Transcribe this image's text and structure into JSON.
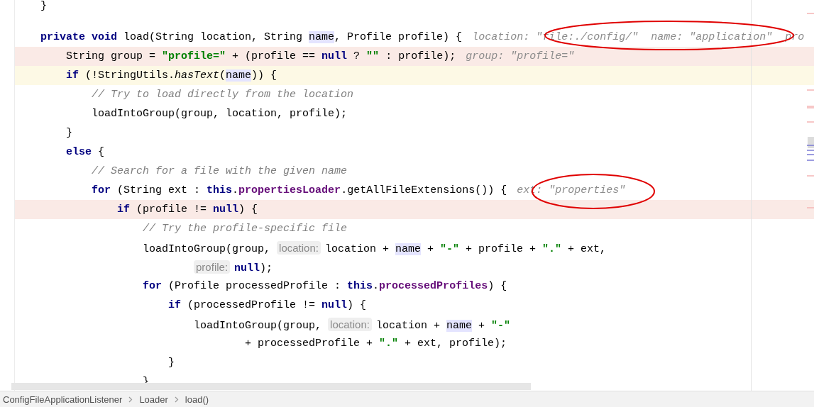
{
  "editor": {
    "lines": [
      {
        "kind": "code",
        "breakpoint": false,
        "caret_line": false,
        "segments": [
          {
            "kind": "code",
            "tokens": [
              {
                "kind": "plain",
                "text": "}"
              }
            ]
          }
        ]
      },
      {
        "kind": "blank",
        "breakpoint": false,
        "caret_line": false
      },
      {
        "kind": "code",
        "breakpoint": false,
        "caret_line": false,
        "segments": [
          {
            "kind": "code",
            "tokens": [
              {
                "kind": "keyword",
                "text": "private void"
              },
              {
                "kind": "plain",
                "text": " load(String location, String "
              },
              {
                "kind": "usage",
                "text": "name"
              },
              {
                "kind": "plain",
                "text": ", Profile profile) {"
              }
            ]
          },
          {
            "kind": "hint",
            "text": "location: \"file:./config/\"  name: \"application\"  pro"
          }
        ],
        "children": [
          {
            "kind": "code",
            "breakpoint": true,
            "caret_line": false,
            "segments": [
              {
                "kind": "code",
                "tokens": [
                  {
                    "kind": "plain",
                    "text": "String group = "
                  },
                  {
                    "kind": "string",
                    "text": "\"profile=\""
                  },
                  {
                    "kind": "plain",
                    "text": " + (profile == "
                  },
                  {
                    "kind": "keyword",
                    "text": "null"
                  },
                  {
                    "kind": "plain",
                    "text": " ? "
                  },
                  {
                    "kind": "string",
                    "text": "\"\""
                  },
                  {
                    "kind": "plain",
                    "text": " : profile);"
                  }
                ]
              },
              {
                "kind": "hint",
                "text": "group: \"profile=\""
              }
            ]
          },
          {
            "kind": "code",
            "breakpoint": false,
            "caret_line": true,
            "segments": [
              {
                "kind": "code",
                "tokens": [
                  {
                    "kind": "keyword",
                    "text": "if"
                  },
                  {
                    "kind": "plain",
                    "text": " (!StringUtils."
                  },
                  {
                    "kind": "method",
                    "text": "hasText"
                  },
                  {
                    "kind": "plain",
                    "text": "("
                  },
                  {
                    "kind": "usage",
                    "text": "name"
                  },
                  {
                    "kind": "plain",
                    "text": ")) {"
                  }
                ]
              }
            ],
            "children": [
              {
                "kind": "code",
                "breakpoint": false,
                "caret_line": false,
                "segments": [
                  {
                    "kind": "code",
                    "tokens": [
                      {
                        "kind": "comment",
                        "text": "// Try to load directly from the location"
                      }
                    ]
                  }
                ]
              },
              {
                "kind": "code",
                "breakpoint": false,
                "caret_line": false,
                "segments": [
                  {
                    "kind": "code",
                    "tokens": [
                      {
                        "kind": "plain",
                        "text": "loadIntoGroup(group, location, profile);"
                      }
                    ]
                  }
                ]
              }
            ]
          },
          {
            "kind": "code",
            "breakpoint": false,
            "caret_line": false,
            "segments": [
              {
                "kind": "code",
                "tokens": [
                  {
                    "kind": "plain",
                    "text": "}"
                  }
                ]
              }
            ]
          },
          {
            "kind": "code",
            "breakpoint": false,
            "caret_line": false,
            "segments": [
              {
                "kind": "code",
                "tokens": [
                  {
                    "kind": "keyword",
                    "text": "else"
                  },
                  {
                    "kind": "plain",
                    "text": " {"
                  }
                ]
              }
            ],
            "children": [
              {
                "kind": "code",
                "breakpoint": false,
                "caret_line": false,
                "segments": [
                  {
                    "kind": "code",
                    "tokens": [
                      {
                        "kind": "comment",
                        "text": "// Search for a file with the given name"
                      }
                    ]
                  }
                ]
              },
              {
                "kind": "code",
                "breakpoint": false,
                "caret_line": false,
                "segments": [
                  {
                    "kind": "code",
                    "tokens": [
                      {
                        "kind": "keyword",
                        "text": "for"
                      },
                      {
                        "kind": "plain",
                        "text": " (String ext : "
                      },
                      {
                        "kind": "keyword",
                        "text": "this"
                      },
                      {
                        "kind": "plain",
                        "text": "."
                      },
                      {
                        "kind": "field",
                        "text": "propertiesLoader"
                      },
                      {
                        "kind": "plain",
                        "text": ".getAllFileExtensions()) {"
                      }
                    ]
                  },
                  {
                    "kind": "hint",
                    "text": "ext: \"properties\""
                  }
                ],
                "children": [
                  {
                    "kind": "code",
                    "breakpoint": true,
                    "caret_line": false,
                    "segments": [
                      {
                        "kind": "code",
                        "tokens": [
                          {
                            "kind": "keyword",
                            "text": "if"
                          },
                          {
                            "kind": "plain",
                            "text": " (profile != "
                          },
                          {
                            "kind": "keyword",
                            "text": "null"
                          },
                          {
                            "kind": "plain",
                            "text": ") {"
                          }
                        ]
                      }
                    ],
                    "children": [
                      {
                        "kind": "code",
                        "breakpoint": false,
                        "caret_line": false,
                        "segments": [
                          {
                            "kind": "code",
                            "tokens": [
                              {
                                "kind": "comment",
                                "text": "// Try the profile-specific file"
                              }
                            ]
                          }
                        ]
                      },
                      {
                        "kind": "code",
                        "breakpoint": false,
                        "caret_line": false,
                        "segments": [
                          {
                            "kind": "code",
                            "tokens": [
                              {
                                "kind": "plain",
                                "text": "loadIntoGroup(group, "
                              }
                            ]
                          },
                          {
                            "kind": "param",
                            "text": "location:"
                          },
                          {
                            "kind": "code",
                            "tokens": [
                              {
                                "kind": "plain",
                                "text": "location + "
                              },
                              {
                                "kind": "usage",
                                "text": "name"
                              },
                              {
                                "kind": "plain",
                                "text": " + "
                              },
                              {
                                "kind": "string",
                                "text": "\"-\""
                              },
                              {
                                "kind": "plain",
                                "text": " + profile + "
                              },
                              {
                                "kind": "string",
                                "text": "\".\""
                              },
                              {
                                "kind": "plain",
                                "text": " + ext,"
                              }
                            ]
                          }
                        ]
                      },
                      {
                        "kind": "continuation",
                        "breakpoint": false,
                        "caret_line": false,
                        "segments": [
                          {
                            "kind": "param",
                            "text": "profile:"
                          },
                          {
                            "kind": "code",
                            "tokens": [
                              {
                                "kind": "keyword",
                                "text": "null"
                              },
                              {
                                "kind": "plain",
                                "text": ");"
                              }
                            ]
                          }
                        ]
                      },
                      {
                        "kind": "code",
                        "breakpoint": false,
                        "caret_line": false,
                        "segments": [
                          {
                            "kind": "code",
                            "tokens": [
                              {
                                "kind": "keyword",
                                "text": "for"
                              },
                              {
                                "kind": "plain",
                                "text": " (Profile processedProfile : "
                              },
                              {
                                "kind": "keyword",
                                "text": "this"
                              },
                              {
                                "kind": "plain",
                                "text": "."
                              },
                              {
                                "kind": "field",
                                "text": "processedProfiles"
                              },
                              {
                                "kind": "plain",
                                "text": ") {"
                              }
                            ]
                          }
                        ],
                        "children": [
                          {
                            "kind": "code",
                            "breakpoint": false,
                            "caret_line": false,
                            "segments": [
                              {
                                "kind": "code",
                                "tokens": [
                                  {
                                    "kind": "keyword",
                                    "text": "if"
                                  },
                                  {
                                    "kind": "plain",
                                    "text": " (processedProfile != "
                                  },
                                  {
                                    "kind": "keyword",
                                    "text": "null"
                                  },
                                  {
                                    "kind": "plain",
                                    "text": ") {"
                                  }
                                ]
                              }
                            ],
                            "children": [
                              {
                                "kind": "code",
                                "breakpoint": false,
                                "caret_line": false,
                                "segments": [
                                  {
                                    "kind": "code",
                                    "tokens": [
                                      {
                                        "kind": "plain",
                                        "text": "loadIntoGroup(group, "
                                      }
                                    ]
                                  },
                                  {
                                    "kind": "param",
                                    "text": "location:"
                                  },
                                  {
                                    "kind": "code",
                                    "tokens": [
                                      {
                                        "kind": "plain",
                                        "text": "location + "
                                      },
                                      {
                                        "kind": "usage",
                                        "text": "name"
                                      },
                                      {
                                        "kind": "plain",
                                        "text": " + "
                                      },
                                      {
                                        "kind": "string",
                                        "text": "\"-\""
                                      }
                                    ]
                                  }
                                ]
                              },
                              {
                                "kind": "continuation",
                                "breakpoint": false,
                                "caret_line": false,
                                "segments": [
                                  {
                                    "kind": "code",
                                    "tokens": [
                                      {
                                        "kind": "plain",
                                        "text": "+ processedProfile + "
                                      },
                                      {
                                        "kind": "string",
                                        "text": "\".\""
                                      },
                                      {
                                        "kind": "plain",
                                        "text": " + ext, profile);"
                                      }
                                    ]
                                  }
                                ]
                              }
                            ]
                          },
                          {
                            "kind": "code",
                            "breakpoint": false,
                            "caret_line": false,
                            "segments": [
                              {
                                "kind": "code",
                                "tokens": [
                                  {
                                    "kind": "plain",
                                    "text": "}"
                                  }
                                ]
                              }
                            ]
                          }
                        ]
                      },
                      {
                        "kind": "code",
                        "breakpoint": false,
                        "caret_line": false,
                        "segments": [
                          {
                            "kind": "code",
                            "tokens": [
                              {
                                "kind": "plain",
                                "text": "}"
                              }
                            ]
                          }
                        ]
                      }
                    ]
                  }
                ]
              }
            ]
          }
        ]
      }
    ]
  },
  "breadcrumbs": [
    {
      "label": "ConfigFileApplicationListener"
    },
    {
      "label": "Loader"
    },
    {
      "label": "load()"
    }
  ]
}
